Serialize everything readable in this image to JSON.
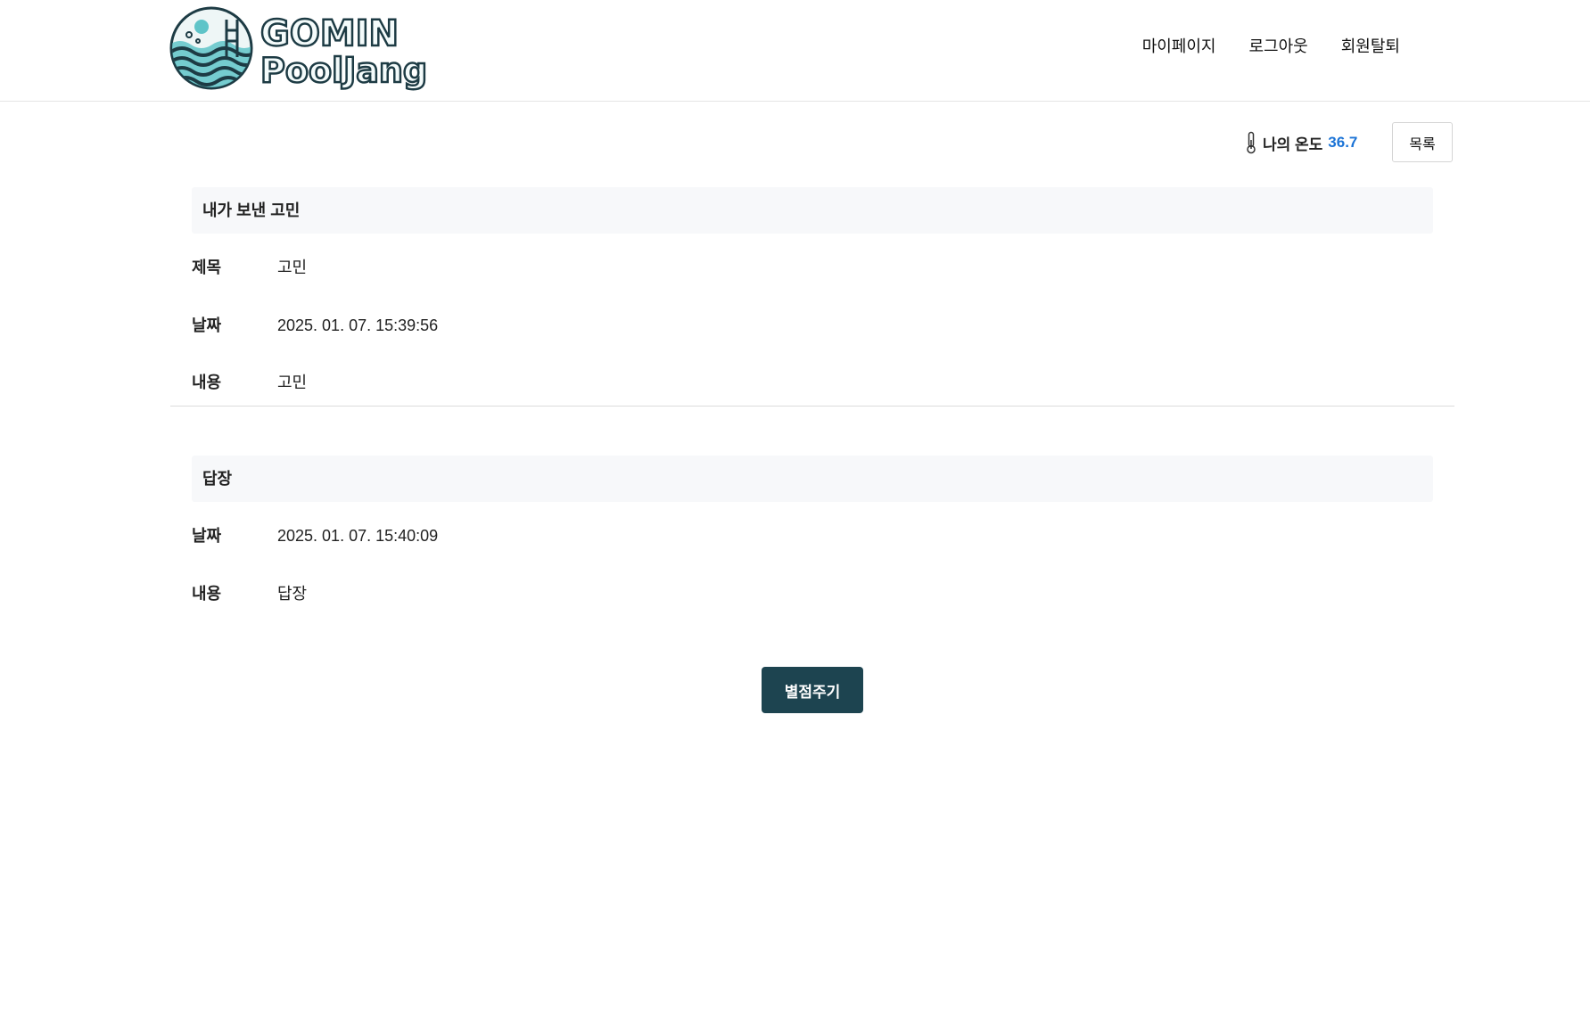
{
  "brand": {
    "line1": "GOMIN",
    "line2": "PoolJang"
  },
  "nav": {
    "mypage": "마이페이지",
    "logout": "로그아웃",
    "withdraw": "회원탈퇴"
  },
  "temperature": {
    "label": "나의 온도",
    "value": "36.7"
  },
  "list_button": "목록",
  "sent": {
    "heading": "내가 보낸 고민",
    "title_label": "제목",
    "title_value": "고민",
    "date_label": "날짜",
    "date_value": "2025. 01. 07. 15:39:56",
    "content_label": "내용",
    "content_value": "고민"
  },
  "reply": {
    "heading": "답장",
    "date_label": "날짜",
    "date_value": "2025. 01. 07. 15:40:09",
    "content_label": "내용",
    "content_value": "답장"
  },
  "rate_button": "별점주기",
  "colors": {
    "accent_dark": "#1d4450",
    "temperature_value": "#1b73d6",
    "section_bg": "#f7f8fa"
  }
}
